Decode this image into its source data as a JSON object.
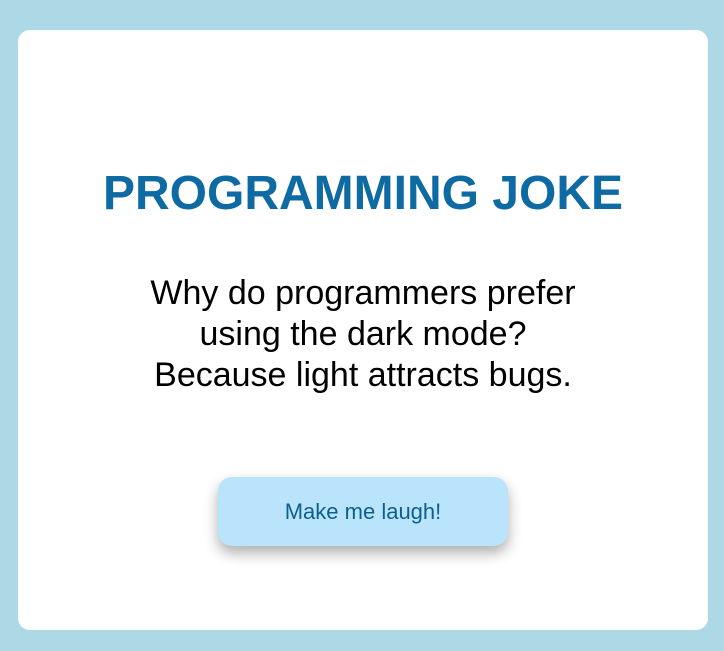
{
  "card": {
    "title": "PROGRAMMING JOKE",
    "joke_lines": [
      "Why do programmers prefer",
      "using the dark mode?",
      "Because light attracts bugs."
    ],
    "button_label": "Make me laugh!"
  },
  "colors": {
    "page_background": "#add8e6",
    "card_background": "#ffffff",
    "title": "#0e6aa3",
    "button_background": "#b9e4fb",
    "button_text": "#0d5f8e"
  }
}
